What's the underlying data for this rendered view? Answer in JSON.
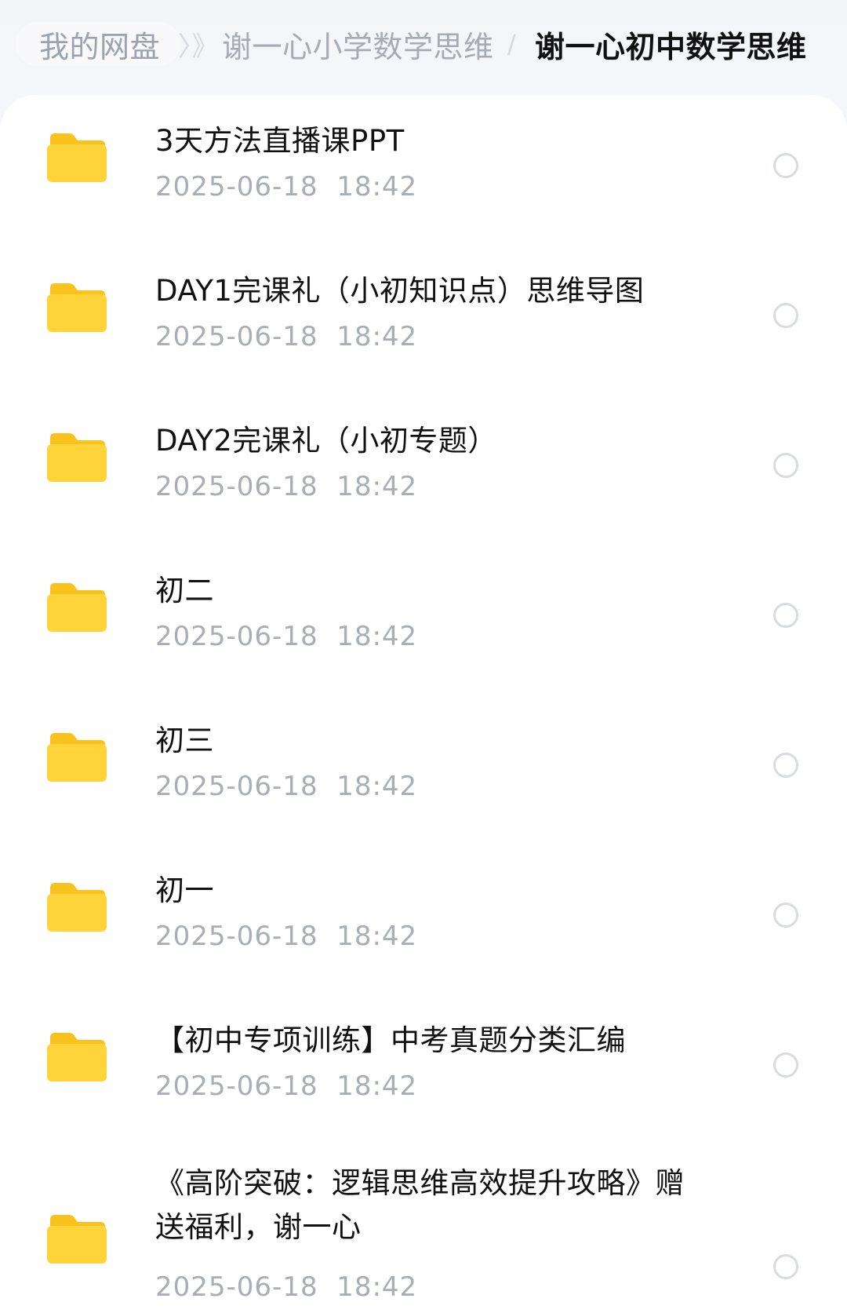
{
  "breadcrumb": {
    "root": "我的网盘",
    "separator1": "〉》",
    "middle": "谢一心小学数学思维",
    "separator2": "/",
    "current": "谢一心初中数学思维"
  },
  "files": [
    {
      "name": "3天方法直播课PPT",
      "modified": "2025-06-18  18:42",
      "icon": "folder-icon"
    },
    {
      "name": "DAY1完课礼（小初知识点）思维导图",
      "modified": "2025-06-18  18:42",
      "icon": "folder-icon"
    },
    {
      "name": "DAY2完课礼（小初专题）",
      "modified": "2025-06-18  18:42",
      "icon": "folder-icon"
    },
    {
      "name": "初二",
      "modified": "2025-06-18  18:42",
      "icon": "folder-icon"
    },
    {
      "name": "初三",
      "modified": "2025-06-18  18:42",
      "icon": "folder-icon"
    },
    {
      "name": "初一",
      "modified": "2025-06-18  18:42",
      "icon": "folder-icon"
    },
    {
      "name": "【初中专项训练】中考真题分类汇编",
      "modified": "2025-06-18  18:42",
      "icon": "folder-icon"
    },
    {
      "name": "《高阶突破：逻辑思维高效提升攻略》赠送福利，谢一心",
      "modified": "2025-06-18  18:42",
      "icon": "folder-icon"
    }
  ],
  "colors": {
    "folder_front": "#FFD43B",
    "folder_back": "#F9C21C",
    "date_text": "#A9ADB4",
    "radio_border": "#D8DBE0"
  }
}
